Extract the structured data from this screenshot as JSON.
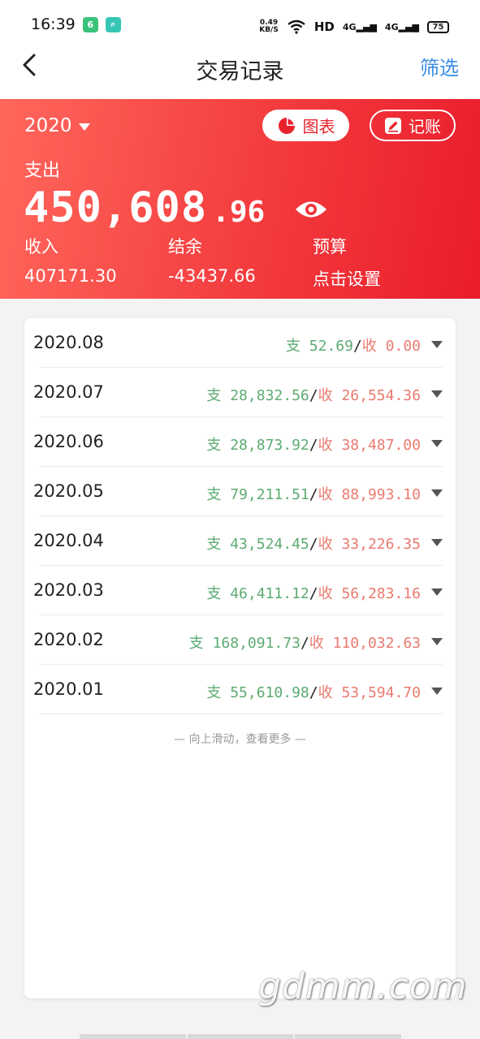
{
  "status_bar": {
    "time": "16:39",
    "net_speed_value": "0.49",
    "net_speed_unit": "KB/S",
    "hd_label": "HD",
    "signal1": "4G",
    "signal2": "4G",
    "battery": "75"
  },
  "nav": {
    "title": "交易记录",
    "filter_label": "筛选"
  },
  "summary": {
    "year": "2020",
    "chart_button_label": "图表",
    "record_button_label": "记账",
    "expense_label": "支出",
    "expense_amount_int": "450,608",
    "expense_amount_dec": ".96",
    "income_label": "收入",
    "income_value": "407171.30",
    "balance_label": "结余",
    "balance_value": "-43437.66",
    "budget_label": "预算",
    "budget_value": "点击设置"
  },
  "months": [
    {
      "month": "2020.08",
      "expense_prefix": "支",
      "expense": "52.69",
      "income_prefix": "收",
      "income": "0.00"
    },
    {
      "month": "2020.07",
      "expense_prefix": "支",
      "expense": "28,832.56",
      "income_prefix": "收",
      "income": "26,554.36"
    },
    {
      "month": "2020.06",
      "expense_prefix": "支",
      "expense": "28,873.92",
      "income_prefix": "收",
      "income": "38,487.00"
    },
    {
      "month": "2020.05",
      "expense_prefix": "支",
      "expense": "79,211.51",
      "income_prefix": "收",
      "income": "88,993.10"
    },
    {
      "month": "2020.04",
      "expense_prefix": "支",
      "expense": "43,524.45",
      "income_prefix": "收",
      "income": "33,226.35"
    },
    {
      "month": "2020.03",
      "expense_prefix": "支",
      "expense": "46,411.12",
      "income_prefix": "收",
      "income": "56,283.16"
    },
    {
      "month": "2020.02",
      "expense_prefix": "支",
      "expense": "168,091.73",
      "income_prefix": "收",
      "income": "110,032.63"
    },
    {
      "month": "2020.01",
      "expense_prefix": "支",
      "expense": "55,610.98",
      "income_prefix": "收",
      "income": "53,594.70"
    }
  ],
  "load_more_hint": "— 向上滑动，查看更多 —",
  "watermark": "gdmm.com",
  "colors": {
    "accent_red": "#ea1c2b",
    "expense_green": "#5cab72",
    "income_red": "#e97a6f",
    "link_blue": "#3a8ee6"
  }
}
